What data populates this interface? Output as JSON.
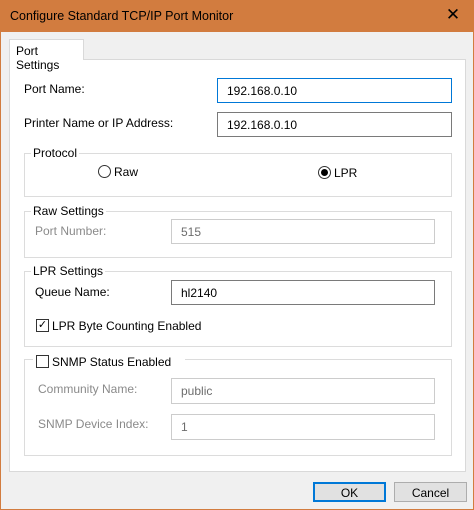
{
  "window": {
    "title": "Configure Standard TCP/IP Port Monitor",
    "accent": "#d27c3f"
  },
  "tab": {
    "label": "Port Settings"
  },
  "port_name": {
    "label": "Port Name:",
    "value": "192.168.0.10"
  },
  "printer_address": {
    "label": "Printer Name or IP Address:",
    "value": "192.168.0.10"
  },
  "protocol": {
    "legend": "Protocol",
    "raw": "Raw",
    "lpr": "LPR",
    "selected": "LPR"
  },
  "raw_settings": {
    "legend": "Raw Settings",
    "port_number_label": "Port Number:",
    "port_number": "515"
  },
  "lpr_settings": {
    "legend": "LPR Settings",
    "queue_label": "Queue Name:",
    "queue": "hl2140",
    "byte_counting_label": "LPR Byte Counting Enabled",
    "byte_counting": true
  },
  "snmp": {
    "label": "SNMP Status Enabled",
    "enabled": false,
    "community_label": "Community Name:",
    "community": "public",
    "index_label": "SNMP Device Index:",
    "index": "1"
  },
  "buttons": {
    "ok": "OK",
    "cancel": "Cancel"
  }
}
